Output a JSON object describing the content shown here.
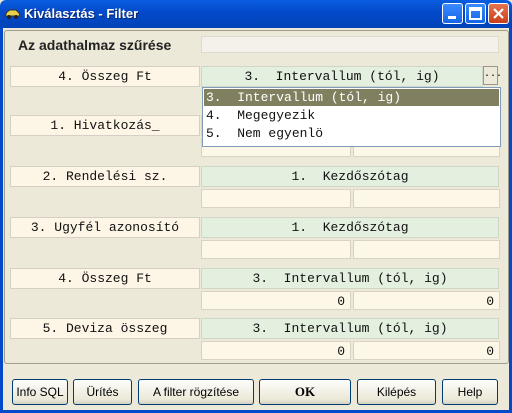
{
  "window": {
    "title": "Kiválasztás - Filter",
    "icon": "car-app-icon",
    "controls": [
      "minimize-icon",
      "maximize-icon",
      "close-icon"
    ]
  },
  "heading": "Az adathalmaz szűrése",
  "filters": [
    {
      "label": "4. Összeg Ft",
      "operator": "3.  Intervallum (tól, ig)"
    },
    {
      "label": "1. Hivatkozás_",
      "operator": "",
      "value_from": "",
      "value_to": ""
    },
    {
      "label": "2. Rendelési sz.",
      "operator": "1.  Kezdőszótag",
      "value_from": "",
      "value_to": ""
    },
    {
      "label": "3. Ugyfél azonosító",
      "operator": "1.  Kezdőszótag",
      "value_from": "",
      "value_to": ""
    },
    {
      "label": "4. Összeg Ft",
      "operator": "3.  Intervallum (tól, ig)",
      "value_from": "0",
      "value_to": "0"
    },
    {
      "label": "5. Deviza összeg",
      "operator": "3.  Intervallum (tól, ig)",
      "value_from": "0",
      "value_to": "0"
    }
  ],
  "dropdown": {
    "button_label": "...",
    "options": [
      "3.  Intervallum (tól, ig)",
      "4.  Megegyezik",
      "5.  Nem egyenlö"
    ],
    "selected_index": 0
  },
  "buttons": {
    "info_sql": "Info SQL",
    "clear": "Ürítés",
    "save_filter": "A filter rögzítése",
    "ok": "OK",
    "exit": "Kilépés",
    "help": "Help"
  }
}
